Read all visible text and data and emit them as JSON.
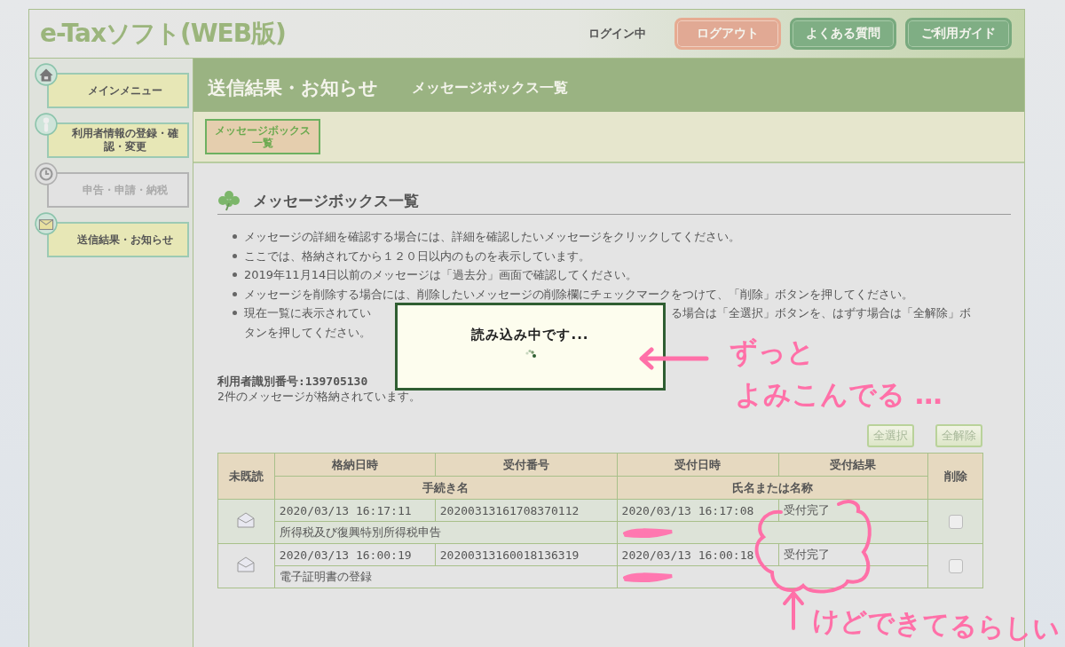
{
  "header": {
    "logo": "e-Taxソフト(WEB版)",
    "login_status": "ログイン中",
    "buttons": [
      {
        "label": "ログアウト",
        "kind": "logout"
      },
      {
        "label": "よくある質問",
        "kind": "nav"
      },
      {
        "label": "ご利用ガイド",
        "kind": "nav"
      }
    ]
  },
  "sidebar": {
    "items": [
      {
        "label": "メインメニュー",
        "kind": "home",
        "disabled": false
      },
      {
        "label": "利用者情報の登録・確認・変更",
        "kind": "person",
        "disabled": false
      },
      {
        "label": "申告・申請・納税",
        "kind": "clock",
        "disabled": true
      },
      {
        "label": "送信結果・お知らせ",
        "kind": "mail",
        "disabled": false
      }
    ]
  },
  "page_header": {
    "title": "送信結果・お知らせ",
    "subtitle": "メッセージボックス一覧"
  },
  "subnav": [
    {
      "label": "メッセージボックス一覧",
      "selected": true
    }
  ],
  "section": {
    "title": "メッセージボックス一覧",
    "notes": [
      {
        "kind": "full",
        "text": "メッセージの詳細を確認する場合には、詳細を確認したいメッセージをクリックしてください。"
      },
      {
        "kind": "full",
        "text": "ここでは、格納されてから１２０日以内のものを表示しています。"
      },
      {
        "kind": "full",
        "text": "2019年11月14日以前のメッセージは「過去分」画面で確認してください。"
      },
      {
        "kind": "full",
        "text": "メッセージを削除する場合には、削除したいメッセージの削除欄にチェックマークをつけて、「削除」ボタンを押してください。"
      },
      {
        "kind": "split",
        "parts": [
          "現在一覧に表示されてい",
          "る場合は「全選択」ボタンを、はずす場合は「全解除」ボ",
          "タンを押してください。"
        ]
      }
    ]
  },
  "user_id": "利用者識別番号:139705130",
  "count_text": "2件のメッセージが格納されています。",
  "select_buttons": [
    "全選択",
    "全解除"
  ],
  "table": {
    "header_row1": [
      "未既読",
      "格納日時",
      "受付番号",
      "受付日時",
      "受付結果",
      "削除"
    ],
    "header_row2": [
      "手続き名",
      "氏名または名称"
    ],
    "rows": [
      {
        "stored": "2020/03/13 16:17:11",
        "number": "20200313161708370112",
        "received": "2020/03/13 16:17:08",
        "result": "受付完了",
        "procedure": "所得税及び復興特別所得税申告",
        "name_redacted": true,
        "checked": false
      },
      {
        "stored": "2020/03/13 16:00:19",
        "number": "20200313160018136319",
        "received": "2020/03/13 16:00:18",
        "result": "受付完了",
        "procedure": "電子証明書の登録",
        "name_redacted": true,
        "checked": false
      }
    ]
  },
  "loading_dialog": {
    "text": "読み込み中です..."
  },
  "annotations": [
    {
      "text": "ずっと"
    },
    {
      "text": "よみこんでる …"
    },
    {
      "text": "けどできてるらしい"
    }
  ]
}
